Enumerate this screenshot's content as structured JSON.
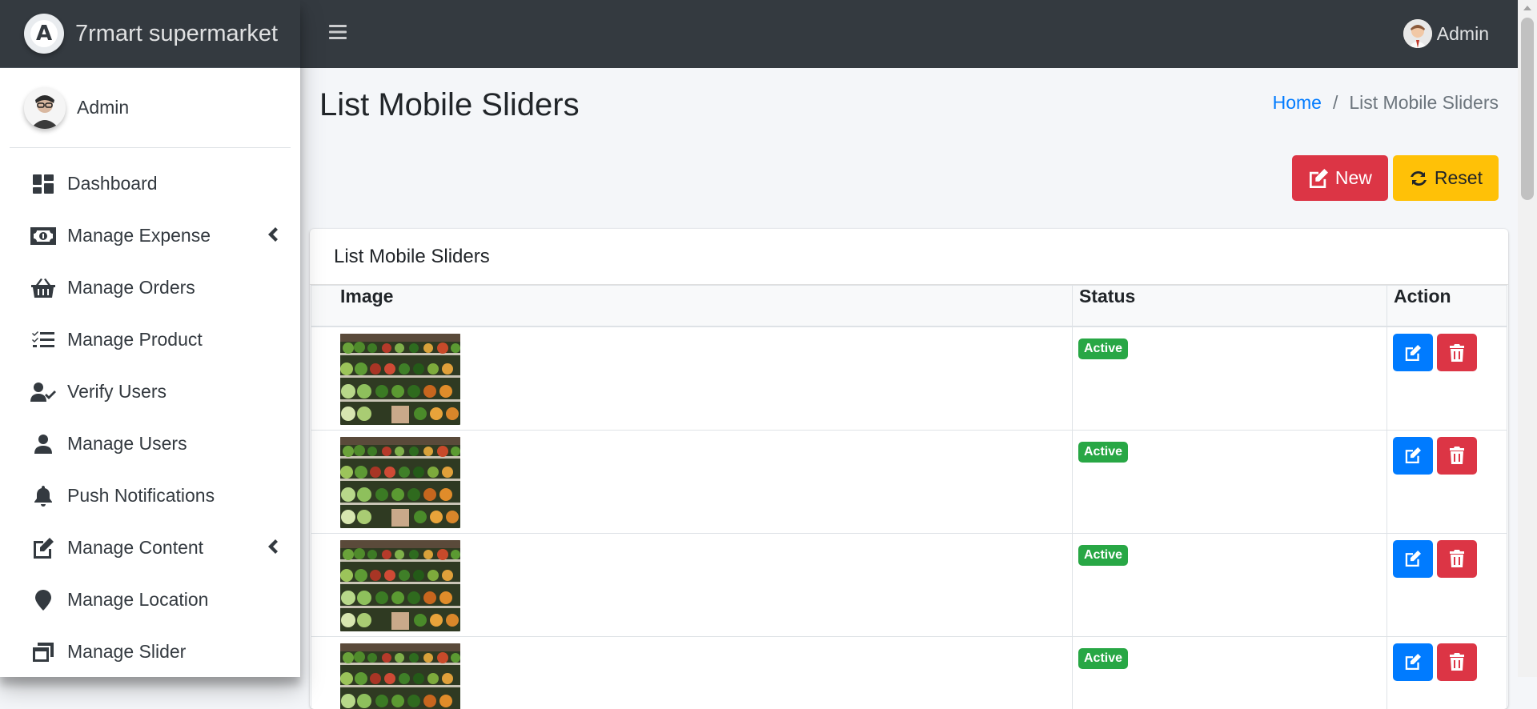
{
  "brand": {
    "name": "7rmart supermarket",
    "logo_letter": "A"
  },
  "sidebar": {
    "user_name": "Admin",
    "items": [
      {
        "label": "Dashboard",
        "icon": "dashboard-icon",
        "has_children": false
      },
      {
        "label": "Manage Expense",
        "icon": "money-bill-icon",
        "has_children": true
      },
      {
        "label": "Manage Orders",
        "icon": "basket-icon",
        "has_children": false
      },
      {
        "label": "Manage Product",
        "icon": "tasks-list-icon",
        "has_children": false
      },
      {
        "label": "Verify Users",
        "icon": "user-check-icon",
        "has_children": false
      },
      {
        "label": "Manage Users",
        "icon": "user-icon",
        "has_children": false
      },
      {
        "label": "Push Notifications",
        "icon": "bell-icon",
        "has_children": false
      },
      {
        "label": "Manage Content",
        "icon": "edit-icon",
        "has_children": true
      },
      {
        "label": "Manage Location",
        "icon": "map-marker-icon",
        "has_children": false
      },
      {
        "label": "Manage Slider",
        "icon": "window-restore-icon",
        "has_children": false
      }
    ]
  },
  "topbar": {
    "user_name": "Admin"
  },
  "page": {
    "title": "List Mobile Sliders",
    "breadcrumb": {
      "home": "Home",
      "separator": "/",
      "current": "List Mobile Sliders"
    }
  },
  "actions": {
    "new_label": "New",
    "reset_label": "Reset"
  },
  "card": {
    "title": "List Mobile Sliders"
  },
  "table": {
    "headers": {
      "image": "Image",
      "status": "Status",
      "action": "Action"
    },
    "rows": [
      {
        "status": "Active"
      },
      {
        "status": "Active"
      },
      {
        "status": "Active"
      },
      {
        "status": "Active"
      }
    ]
  },
  "colors": {
    "navbar": "#343a40",
    "primary": "#007bff",
    "danger": "#dc3545",
    "warning": "#ffc107",
    "success": "#28a745"
  }
}
